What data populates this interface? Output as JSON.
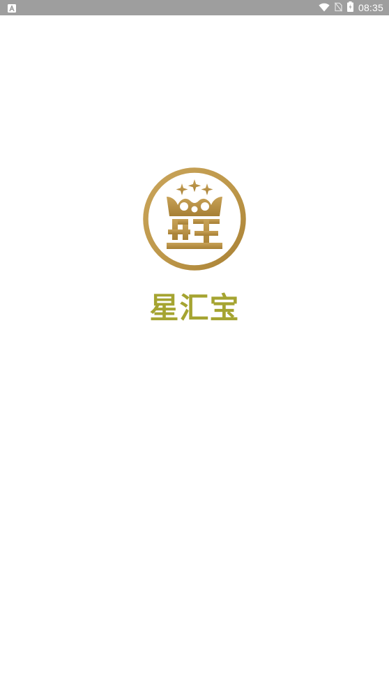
{
  "status_bar": {
    "time": "08:35",
    "left_icon": "a-notification-icon",
    "right_icons": [
      "wifi-icon",
      "no-sim-icon",
      "battery-icon"
    ],
    "background_color": "#9e9e9e",
    "text_color": "#ffffff"
  },
  "splash": {
    "background_color": "#ffffff",
    "logo": {
      "icon": "crown-emblem-icon",
      "ring_color": "#c19a4f",
      "crown_color": "#b8903f"
    },
    "brand_name": "星汇宝",
    "brand_color": "#a5a431"
  }
}
